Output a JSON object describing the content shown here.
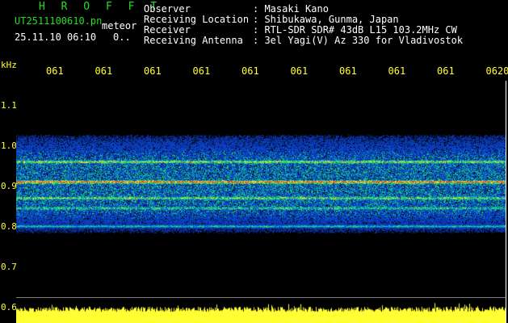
{
  "header": {
    "brand": "H R O F F T",
    "file_name": "UT2511100610.pn",
    "file_type": "meteor",
    "datetime": "25.11.10 06:10",
    "flag": "0..",
    "observer_label": "Observer",
    "observer": "Masaki Kano",
    "location_label": "Receiving Location",
    "location": "Shibukawa, Gunma, Japan",
    "receiver_label": "Receiver",
    "receiver": "RTL-SDR SDR# 43dB L15 103.2MHz CW",
    "antenna_label": "Receiving Antenna",
    "antenna": "3el Yagi(V) Az 330 for Vladivostok"
  },
  "axis": {
    "unit": "kHz",
    "x_ticks": [
      "061",
      "061",
      "061",
      "061",
      "061",
      "061",
      "061",
      "061",
      "061",
      "0620"
    ],
    "y_ticks": [
      "1.1",
      "1.0",
      "0.9",
      "0.8",
      "0.7",
      "0.6"
    ]
  },
  "colors": {
    "background": "#000000",
    "noise_floor": "#0a1a8c",
    "signal": "#22ff44",
    "hot": "#ff3322",
    "yellow": "#ffff33"
  },
  "chart_data": {
    "type": "heatmap",
    "ylabel": "kHz",
    "ylim": [
      0.6,
      1.15
    ],
    "bands": [
      {
        "freq": 0.96,
        "strength": 0.55
      },
      {
        "freq": 0.91,
        "strength": 0.95
      },
      {
        "freq": 0.87,
        "strength": 0.45
      },
      {
        "freq": 0.845,
        "strength": 0.35
      },
      {
        "freq": 0.8,
        "strength": 0.45
      }
    ],
    "noise_band": [
      0.78,
      1.03
    ]
  }
}
